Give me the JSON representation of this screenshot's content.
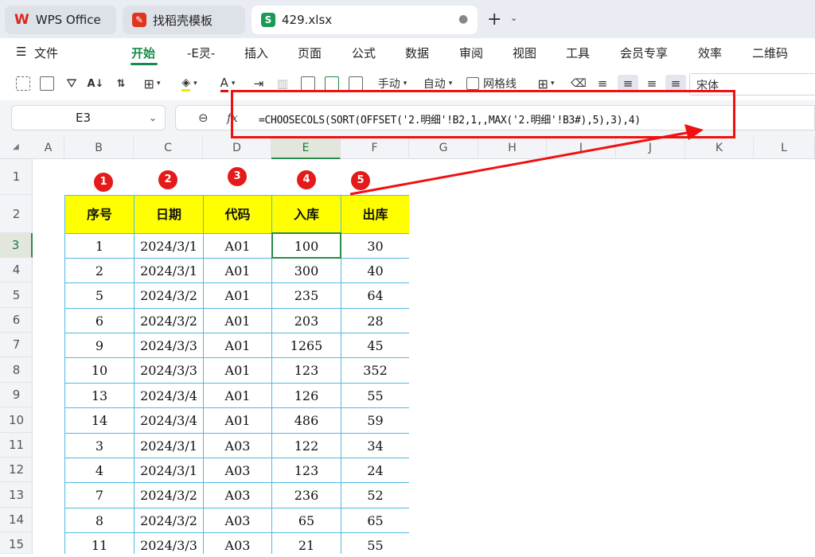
{
  "tabs": [
    {
      "label": "WPS Office",
      "icon": "wps-logo-icon"
    },
    {
      "label": "找稻壳模板",
      "icon": "docer-icon"
    },
    {
      "label": "429.xlsx",
      "icon": "spreadsheet-s-icon"
    }
  ],
  "menu": [
    "文件",
    "开始",
    "-E灵-",
    "插入",
    "页面",
    "公式",
    "数据",
    "审阅",
    "视图",
    "工具",
    "会员专享",
    "效率",
    "二维码"
  ],
  "toolbar": {
    "wrap_label": "手动",
    "auto_label": "自动",
    "gridlines_label": "网格线",
    "font_name": "宋体"
  },
  "formula_bar": {
    "name_box": "E3",
    "fx_label": "fx",
    "formula": "=CHOOSECOLS(SORT(OFFSET('2.明细'!B2,1,,MAX('2.明细'!B3#),5),3),4)"
  },
  "columns": [
    "A",
    "B",
    "C",
    "D",
    "E",
    "F",
    "G",
    "H",
    "I",
    "J",
    "K",
    "L"
  ],
  "rows": [
    "1",
    "2",
    "3",
    "4",
    "5",
    "6",
    "7",
    "8",
    "9",
    "10",
    "11",
    "12",
    "13",
    "14",
    "15"
  ],
  "markers": [
    "1",
    "2",
    "3",
    "4",
    "5"
  ],
  "table": {
    "headers": [
      "序号",
      "日期",
      "代码",
      "入库",
      "出库"
    ],
    "rows": [
      [
        "1",
        "2024/3/1",
        "A01",
        "100",
        "30"
      ],
      [
        "2",
        "2024/3/1",
        "A01",
        "300",
        "40"
      ],
      [
        "5",
        "2024/3/2",
        "A01",
        "235",
        "64"
      ],
      [
        "6",
        "2024/3/2",
        "A01",
        "203",
        "28"
      ],
      [
        "9",
        "2024/3/3",
        "A01",
        "1265",
        "45"
      ],
      [
        "10",
        "2024/3/3",
        "A01",
        "123",
        "352"
      ],
      [
        "13",
        "2024/3/4",
        "A01",
        "126",
        "55"
      ],
      [
        "14",
        "2024/3/4",
        "A01",
        "486",
        "59"
      ],
      [
        "3",
        "2024/3/1",
        "A03",
        "122",
        "34"
      ],
      [
        "4",
        "2024/3/1",
        "A03",
        "123",
        "24"
      ],
      [
        "7",
        "2024/3/2",
        "A03",
        "236",
        "52"
      ],
      [
        "8",
        "2024/3/2",
        "A03",
        "65",
        "65"
      ],
      [
        "11",
        "2024/3/3",
        "A03",
        "21",
        "55"
      ]
    ]
  },
  "colors": {
    "accent_green": "#1a8a4a",
    "header_yellow": "#ffff00",
    "border_blue": "#4fb9e0",
    "annotation_red": "#f01010"
  }
}
